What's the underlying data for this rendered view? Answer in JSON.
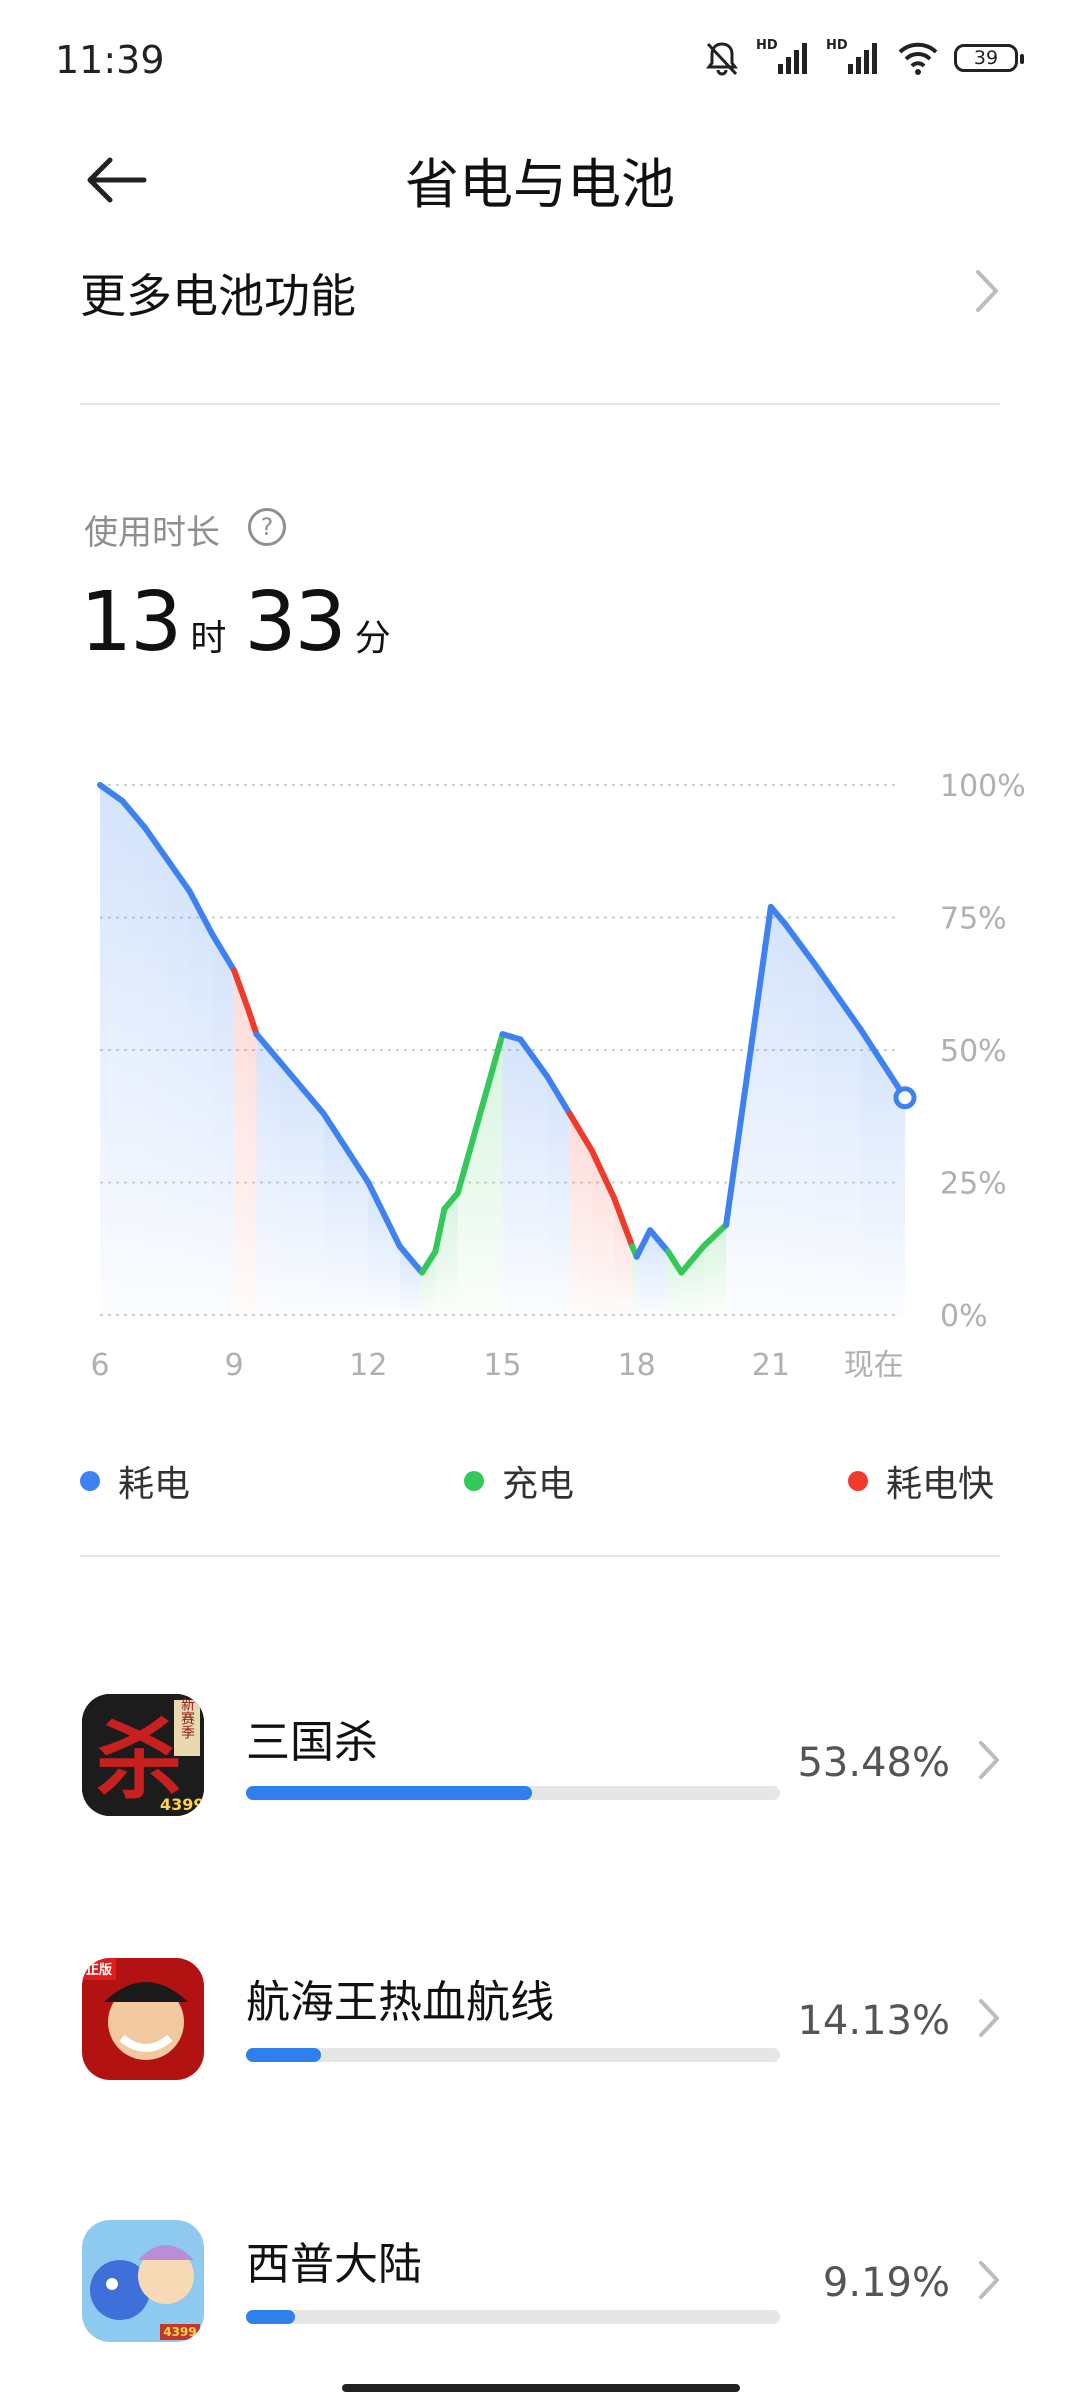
{
  "status": {
    "time": "11:39",
    "battery": "39",
    "hd1": "HD",
    "hd2": "HD"
  },
  "header": {
    "title": "省电与电池"
  },
  "more": {
    "label": "更多电池功能"
  },
  "usage": {
    "label": "使用时长",
    "hours": "13",
    "hours_unit": "时",
    "minutes": "33",
    "minutes_unit": "分"
  },
  "chart_data": {
    "type": "line",
    "x_ticks": [
      "6",
      "9",
      "12",
      "15",
      "18",
      "21",
      "现在"
    ],
    "y_ticks": [
      "100%",
      "75%",
      "50%",
      "25%",
      "0%"
    ],
    "ylim": [
      0,
      100
    ],
    "grid": true,
    "series": [
      {
        "name": "耗电",
        "color": "#3d82f0"
      },
      {
        "name": "充电",
        "color": "#34c759"
      },
      {
        "name": "耗电快",
        "color": "#f03a2b"
      }
    ],
    "points": [
      [
        6,
        100
      ],
      [
        6.5,
        97
      ],
      [
        7,
        92
      ],
      [
        7.5,
        86
      ],
      [
        8,
        80
      ],
      [
        8.5,
        72
      ],
      [
        9,
        65
      ],
      [
        9.3,
        58
      ],
      [
        9.5,
        53
      ],
      [
        10,
        48
      ],
      [
        11,
        38
      ],
      [
        12,
        25
      ],
      [
        12.7,
        13
      ],
      [
        13.2,
        8
      ],
      [
        13.5,
        12
      ],
      [
        13.7,
        20
      ],
      [
        14,
        23
      ],
      [
        15,
        53
      ],
      [
        15.4,
        52
      ],
      [
        16,
        45
      ],
      [
        16.5,
        38
      ],
      [
        17,
        31
      ],
      [
        17.5,
        22
      ],
      [
        17.9,
        13
      ],
      [
        18,
        11
      ],
      [
        18.3,
        16
      ],
      [
        18.7,
        12
      ],
      [
        19,
        8
      ],
      [
        19.5,
        13
      ],
      [
        20,
        17
      ],
      [
        21,
        77
      ],
      [
        21.3,
        74
      ],
      [
        22,
        66
      ],
      [
        23,
        54
      ],
      [
        24,
        41
      ]
    ],
    "segment_series": [
      "耗电",
      "耗电",
      "耗电",
      "耗电",
      "耗电",
      "耗电",
      "耗电快",
      "耗电快",
      "耗电",
      "耗电",
      "耗电",
      "耗电",
      "耗电",
      "充电",
      "充电",
      "充电",
      "充电",
      "耗电",
      "耗电",
      "耗电",
      "耗电快",
      "耗电快",
      "耗电快",
      "充电",
      "耗电",
      "耗电",
      "充电",
      "充电",
      "充电",
      "耗电",
      "耗电",
      "耗电",
      "耗电",
      "耗电"
    ],
    "now_x": 24
  },
  "legend": [
    {
      "label": "耗电",
      "color": "#3d82f0"
    },
    {
      "label": "充电",
      "color": "#34c759"
    },
    {
      "label": "耗电快",
      "color": "#f03a2b"
    }
  ],
  "apps": [
    {
      "name": "三国杀",
      "percent": "53.48%",
      "fraction": 0.5348
    },
    {
      "name": "航海王热血航线",
      "percent": "14.13%",
      "fraction": 0.1413
    },
    {
      "name": "西普大陆",
      "percent": "9.19%",
      "fraction": 0.0919
    }
  ],
  "icons": {
    "app1_badge": "新赛季",
    "app1_glyph": "杀",
    "app1_sub": "4399",
    "app2_badge": "正版",
    "app3_sub": "4399"
  }
}
